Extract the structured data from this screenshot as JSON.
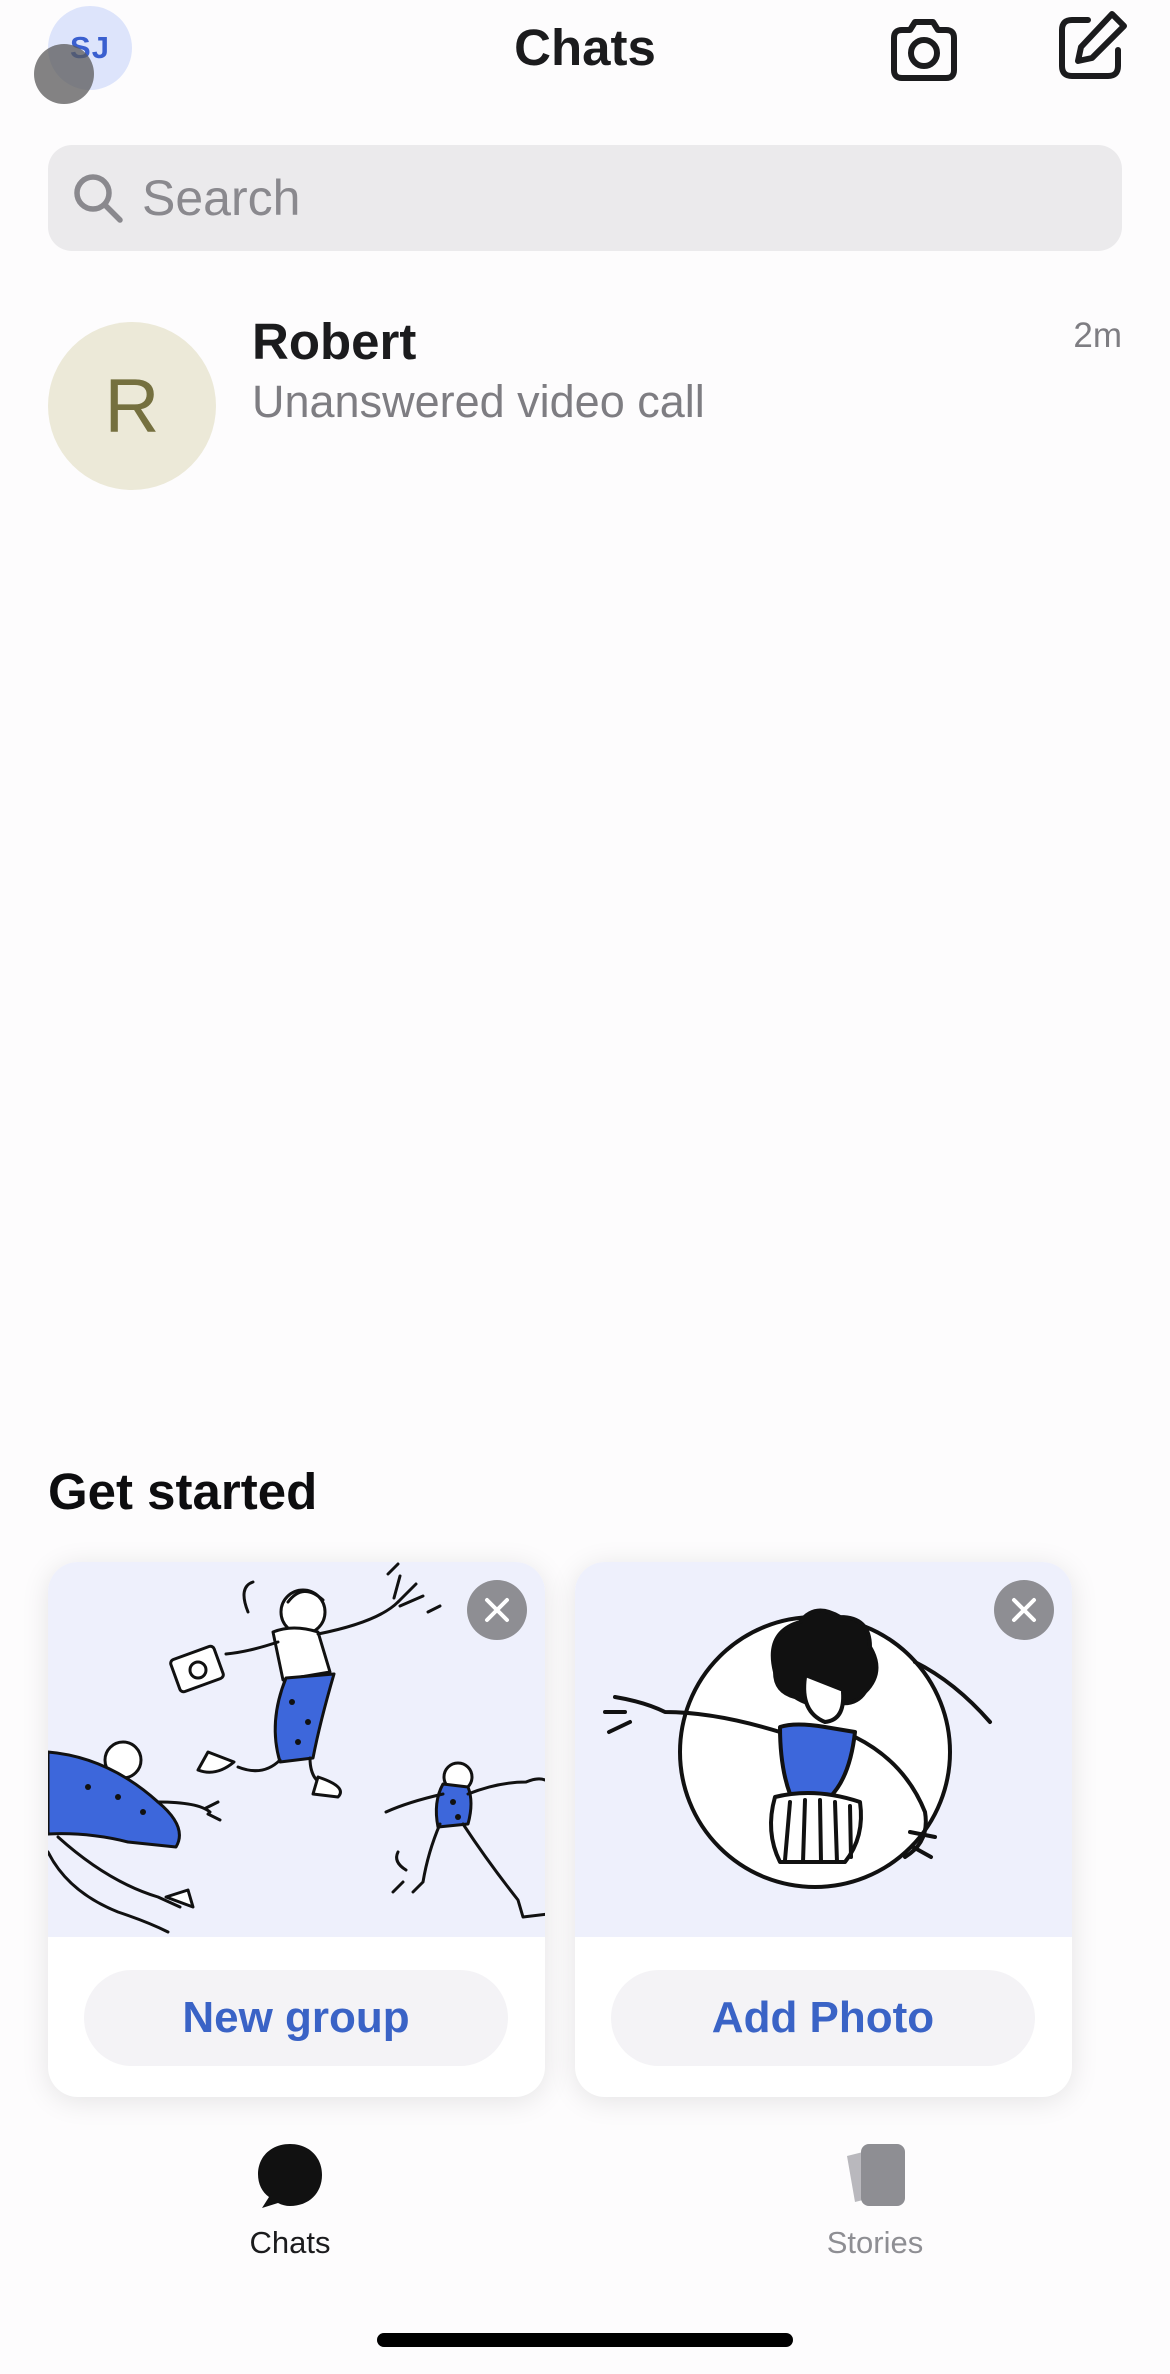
{
  "header": {
    "profile_initials": "SJ",
    "title": "Chats",
    "camera_icon": "camera-icon",
    "compose_icon": "compose-icon"
  },
  "search": {
    "placeholder": "Search",
    "icon": "search-icon"
  },
  "chats": [
    {
      "avatar_initial": "R",
      "name": "Robert",
      "preview": "Unanswered video call",
      "time": "2m"
    }
  ],
  "get_started": {
    "heading": "Get started",
    "cards": [
      {
        "button_label": "New group",
        "illustration": "dancing-people-illustration",
        "close_icon": "close-icon"
      },
      {
        "button_label": "Add Photo",
        "illustration": "profile-photo-illustration",
        "close_icon": "close-icon"
      }
    ]
  },
  "tab_bar": {
    "items": [
      {
        "label": "Chats",
        "icon": "chat-bubble-icon",
        "active": true
      },
      {
        "label": "Stories",
        "icon": "stories-icon",
        "active": false
      }
    ]
  },
  "colors": {
    "accent": "#3a63c6",
    "avatar_me_bg": "#dde4fb",
    "avatar_chat_bg": "#ece9d8",
    "illustration_bg": "#eef0fc",
    "illustration_blue": "#3d67db"
  }
}
